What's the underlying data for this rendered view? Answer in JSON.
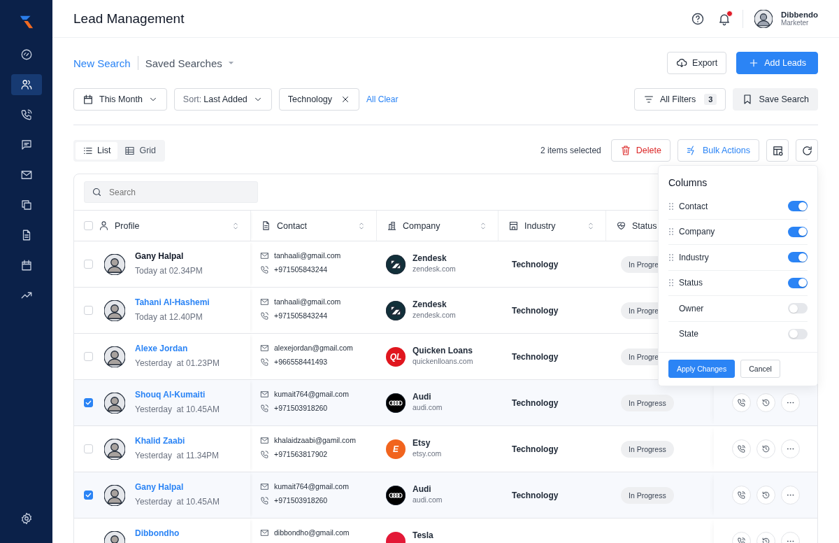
{
  "sidebar": {
    "items": [
      {
        "selected": false
      },
      {
        "selected": true
      },
      {
        "selected": false
      },
      {
        "selected": false
      },
      {
        "selected": false
      },
      {
        "selected": false
      },
      {
        "selected": false
      },
      {
        "selected": false
      },
      {
        "selected": false
      }
    ],
    "settings": {
      "selected": false
    }
  },
  "header": {
    "title": "Lead Management",
    "notification_badge": true,
    "user": {
      "name": "Dibbendo",
      "role": "Marketer"
    }
  },
  "search_tabs": [
    {
      "label": "New Search",
      "selected": true
    },
    {
      "label": "Saved Searches",
      "selected": false
    }
  ],
  "export_button": "Export",
  "add_button": "Add Leads",
  "filters": {
    "date": "This Month",
    "sort_prefix": "Sort:",
    "sort_value": "Last Added",
    "chip": "Technology",
    "clear": "All Clear",
    "all_filters": "All Filters",
    "filter_count": "3",
    "save_search": "Save Search"
  },
  "views": [
    {
      "label": "List",
      "selected": true
    },
    {
      "label": "Grid",
      "selected": false
    }
  ],
  "selection": "2 items selected",
  "delete_button": "Delete",
  "bulk_button": "Bulk Actions",
  "table": {
    "search": {
      "placeholder": "Search"
    },
    "all_selected": false,
    "columns": [
      "Profile",
      "Contact",
      "Company",
      "Industry",
      "Status"
    ],
    "rows": [
      {
        "selected": false,
        "linked": false,
        "name": "Gany Halpal",
        "time": "Today at 02.34PM",
        "email": "tanhaali@gmail.com",
        "phone": "+971505843244",
        "company": {
          "kind": "z-mark",
          "color": "#12303a",
          "name": "Zendesk",
          "domain": "zendesk.com"
        },
        "industry": "Technology",
        "status": "In Progre"
      },
      {
        "selected": false,
        "linked": true,
        "name": "Tahani Al-Hashemi",
        "time": "Today at 12.40PM",
        "email": "tanhaali@gmail.com",
        "phone": "+971505843244",
        "company": {
          "kind": "z-mark",
          "color": "#12303a",
          "name": "Zendesk",
          "domain": "zendesk.com"
        },
        "industry": "Technology",
        "status": "In Progre"
      },
      {
        "selected": false,
        "linked": true,
        "name": "Alexe Jordan",
        "time": "Yesterday  at 01.23PM",
        "email": "alexejordan@gmail.com",
        "phone": "+966558441493",
        "company": {
          "kind": "letters",
          "logo_text": "QL",
          "color": "#e0161e",
          "name": "Quicken Loans",
          "domain": "quickenlloans.com"
        },
        "industry": "Technology",
        "status": "In Progre"
      },
      {
        "selected": true,
        "linked": true,
        "name": "Shouq Al-Kumaiti",
        "time": "Yesterday  at 10.45AM",
        "email": "kumait764@gmail.com",
        "phone": "+971503918260",
        "company": {
          "kind": "rings",
          "color": "#000000",
          "name": "Audi",
          "domain": "audi.com"
        },
        "industry": "Technology",
        "status": "In Progress",
        "actions": true
      },
      {
        "selected": false,
        "linked": true,
        "name": "Khalid Zaabi",
        "time": "Yesterday  at 11.34PM",
        "email": "khalaidzaabi@gamil.com",
        "phone": "+971563817902",
        "company": {
          "kind": "letters",
          "logo_text": "E",
          "color": "#f1641e",
          "name": "Etsy",
          "domain": "etsy.com"
        },
        "industry": "Technology",
        "status": "In Progress",
        "actions": true
      },
      {
        "selected": true,
        "linked": true,
        "name": "Gany Halpal",
        "time": "Yesterday  at 10.45AM",
        "email": "kumait764@gmail.com",
        "phone": "+971503918260",
        "company": {
          "kind": "rings",
          "color": "#000000",
          "name": "Audi",
          "domain": "audi.com"
        },
        "industry": "Technology",
        "status": "In Progress",
        "actions": true
      },
      {
        "linked": true,
        "name": "Dibbondho",
        "email": "dibbondho@gmail.com",
        "company": {
          "kind": "plain",
          "color": "#e31937",
          "name": "Tesla"
        },
        "actions": true
      }
    ]
  },
  "columns_menu": {
    "title": "Columns",
    "items": [
      {
        "label": "Contact",
        "on": true,
        "draggable": true
      },
      {
        "label": "Company",
        "on": true,
        "draggable": true
      },
      {
        "label": "Industry",
        "on": true,
        "draggable": true
      },
      {
        "label": "Status",
        "on": true,
        "draggable": true
      },
      {
        "label": "Owner",
        "on": false,
        "draggable": false
      },
      {
        "label": "State",
        "on": false,
        "draggable": false
      }
    ],
    "apply": "Apply Changes",
    "cancel": "Cancel"
  }
}
